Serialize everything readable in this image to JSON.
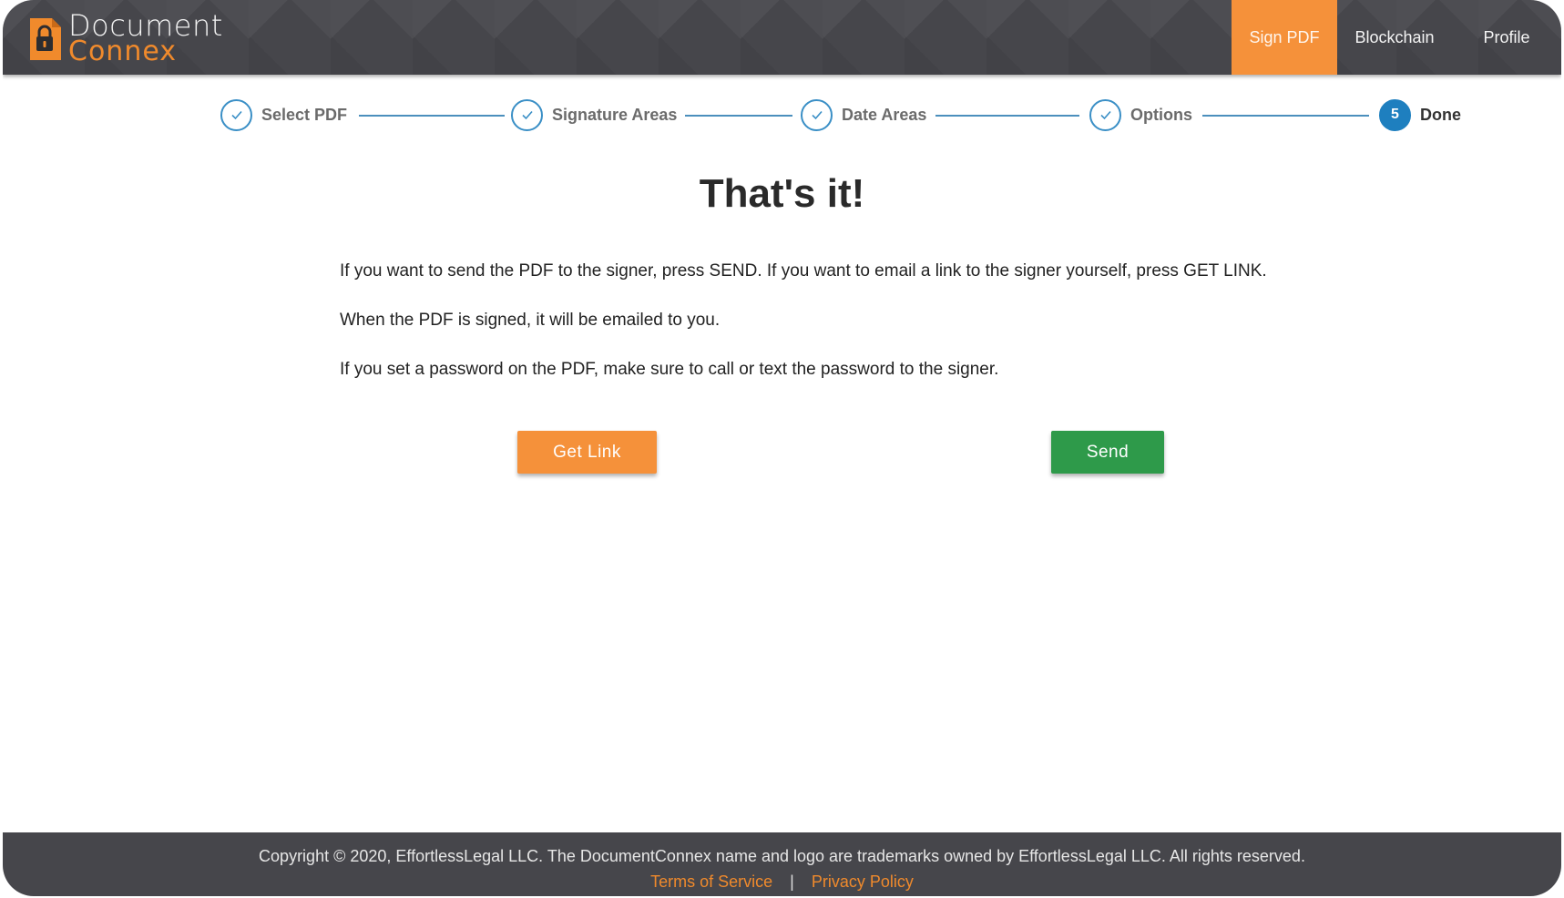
{
  "header": {
    "logo": {
      "line1": "Document",
      "line2": "Connex",
      "icon": "padlock-document-icon"
    },
    "nav": [
      {
        "label": "Sign PDF",
        "active": true
      },
      {
        "label": "Blockchain",
        "active": false
      },
      {
        "label": "Profile",
        "active": false
      }
    ],
    "colors": {
      "background": "#46464b",
      "accent": "#f5913a"
    }
  },
  "stepper": {
    "steps": [
      {
        "label": "Select PDF",
        "status": "complete",
        "icon": "checkmark-icon"
      },
      {
        "label": "Signature Areas",
        "status": "complete",
        "icon": "checkmark-icon"
      },
      {
        "label": "Date Areas",
        "status": "complete",
        "icon": "checkmark-icon"
      },
      {
        "label": "Options",
        "status": "complete",
        "icon": "checkmark-icon"
      },
      {
        "label": "Done",
        "status": "active",
        "number": "5"
      }
    ],
    "colors": {
      "complete": "#3a8fc6",
      "active": "#1e7fbf"
    }
  },
  "main": {
    "title": "That's it!",
    "paragraphs": [
      "If you want to send the PDF to the signer, press SEND. If you want to email a link to the signer yourself, press GET LINK.",
      "When the PDF is signed, it will be emailed to you.",
      "If you set a password on the PDF, make sure to call or text the password to the signer."
    ],
    "buttons": {
      "get_link": "Get Link",
      "send": "Send"
    },
    "colors": {
      "get_link": "#f5913a",
      "send": "#2e9a4a"
    }
  },
  "footer": {
    "copyright": "Copyright © 2020, EffortlessLegal LLC. The DocumentConnex name and logo are trademarks owned by EffortlessLegal LLC. All rights reserved.",
    "links": [
      "Terms of Service",
      "Privacy Policy"
    ],
    "separator": "|"
  }
}
